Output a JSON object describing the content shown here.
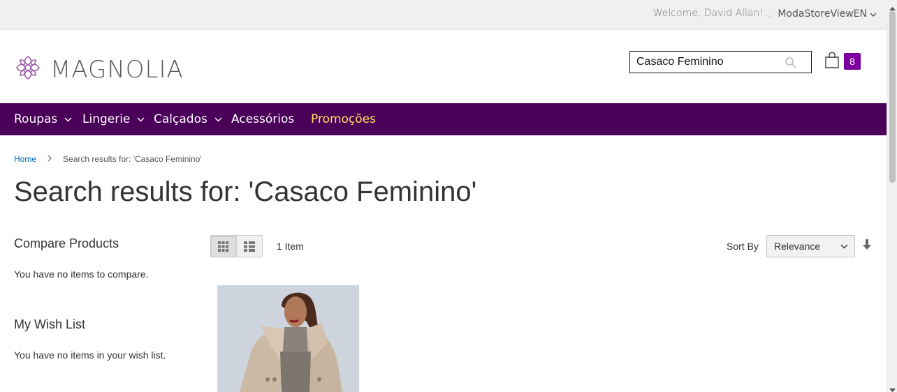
{
  "topbar": {
    "welcome": "Welcome, David Allan!",
    "store_view": "ModaStoreViewEN"
  },
  "header": {
    "logo_text": "MAGNOLIA",
    "search_value": "Casaco Feminino",
    "cart_count": "8"
  },
  "nav": {
    "items": [
      {
        "label": "Roupas",
        "has_dropdown": true
      },
      {
        "label": "Lingerie",
        "has_dropdown": true
      },
      {
        "label": "Calçados",
        "has_dropdown": true
      },
      {
        "label": "Acessórios",
        "has_dropdown": false
      },
      {
        "label": "Promoções",
        "has_dropdown": false
      }
    ]
  },
  "breadcrumb": {
    "home": "Home",
    "current": "Search results for: 'Casaco Feminino'"
  },
  "page_title": "Search results for: 'Casaco Feminino'",
  "sidebar": {
    "compare_title": "Compare Products",
    "compare_empty": "You have no items to compare.",
    "wishlist_title": "My Wish List",
    "wishlist_empty": "You have no items in your wish list."
  },
  "toolbar": {
    "amount": "1 Item",
    "sort_label": "Sort By",
    "sort_value": "Relevance"
  },
  "colors": {
    "nav_bg": "#4a0058",
    "promo": "#ffe45c",
    "badge": "#7b009f",
    "link": "#006bb4"
  },
  "icons": [
    "magnolia-logo-icon",
    "chevron-down-icon",
    "search-icon",
    "shopping-bag-icon",
    "grid-view-icon",
    "list-view-icon",
    "sort-arrow-down-icon"
  ]
}
